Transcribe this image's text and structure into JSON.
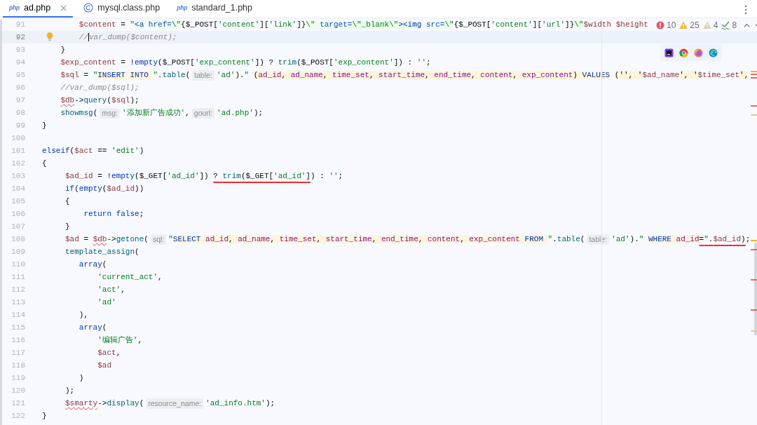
{
  "tabs": [
    {
      "label": "ad.php",
      "kind": "php",
      "badge": "php",
      "selected": true,
      "closable": true
    },
    {
      "label": "mysql.class.php",
      "kind": "class",
      "selected": false,
      "closable": false
    },
    {
      "label": "standard_1.php",
      "kind": "php",
      "badge": "php",
      "selected": false,
      "closable": false
    }
  ],
  "inspections": [
    {
      "kind": "error",
      "count": "10"
    },
    {
      "kind": "warning",
      "count": "25"
    },
    {
      "kind": "weak",
      "count": "4"
    },
    {
      "kind": "typo",
      "count": "8"
    }
  ],
  "lines": [
    {
      "number": "91",
      "current": false,
      "tokens": [
        {
          "text": "        $content",
          "kind": "var"
        },
        {
          "text": " = ",
          "kind": "plain"
        },
        {
          "text": "\"",
          "kind": "str"
        },
        {
          "text": "<a",
          "kind": "htag"
        },
        {
          "text": " href=",
          "kind": "hattr"
        },
        {
          "text": "\\\"",
          "kind": "hstr"
        },
        {
          "text": "{$_POST[",
          "kind": "plain"
        },
        {
          "text": "'content'",
          "kind": "str"
        },
        {
          "text": "][",
          "kind": "plain"
        },
        {
          "text": "'link'",
          "kind": "str"
        },
        {
          "text": "]}",
          "kind": "plain"
        },
        {
          "text": "\\\" ",
          "kind": "hstr"
        },
        {
          "text": "target=",
          "kind": "hattr"
        },
        {
          "text": "\\\"_blank\\\"",
          "kind": "hstr"
        },
        {
          "text": "><img",
          "kind": "htag"
        },
        {
          "text": " src=",
          "kind": "hattr"
        },
        {
          "text": "\\\"",
          "kind": "hstr"
        },
        {
          "text": "{$_POST[",
          "kind": "plain"
        },
        {
          "text": "'content'",
          "kind": "str"
        },
        {
          "text": "][",
          "kind": "plain"
        },
        {
          "text": "'url'",
          "kind": "str"
        },
        {
          "text": "]}",
          "kind": "plain"
        },
        {
          "text": "\\\"",
          "kind": "hstr"
        },
        {
          "text": "$width ",
          "kind": "var"
        },
        {
          "text": "$height",
          "kind": "var"
        }
      ]
    },
    {
      "number": "92",
      "current": true,
      "bulb": true,
      "tokens": [
        {
          "text": "        //",
          "kind": "comment"
        },
        {
          "text": "var_dump($content);",
          "kind": "comment",
          "caret_before": true
        }
      ]
    },
    {
      "number": "93",
      "current": false,
      "tokens": [
        {
          "text": "    }",
          "kind": "plain"
        }
      ]
    },
    {
      "number": "94",
      "current": false,
      "tokens": [
        {
          "text": "    $exp_content",
          "kind": "var"
        },
        {
          "text": " = !",
          "kind": "plain"
        },
        {
          "text": "empty",
          "kind": "kw"
        },
        {
          "text": "($_POST[",
          "kind": "plain"
        },
        {
          "text": "'exp_content'",
          "kind": "str"
        },
        {
          "text": "]) ? ",
          "kind": "plain"
        },
        {
          "text": "trim",
          "kind": "fn"
        },
        {
          "text": "($_POST[",
          "kind": "plain"
        },
        {
          "text": "'exp_content'",
          "kind": "str"
        },
        {
          "text": "]) : ",
          "kind": "plain"
        },
        {
          "text": "''",
          "kind": "str"
        },
        {
          "text": ";",
          "kind": "plain"
        }
      ]
    },
    {
      "number": "95",
      "current": false,
      "tokens": [
        {
          "text": "    $sql",
          "kind": "var"
        },
        {
          "text": " = ",
          "kind": "plain"
        },
        {
          "text": "\"",
          "kind": "str"
        },
        {
          "text": "INSERT INTO ",
          "kind": "sqlkw"
        },
        {
          "text": "\"",
          "kind": "str"
        },
        {
          "text": ".",
          "kind": "plain"
        },
        {
          "text": "table",
          "kind": "fn"
        },
        {
          "text": "(",
          "kind": "plain"
        },
        {
          "text": "table:",
          "kind": "hint"
        },
        {
          "text": "'ad'",
          "kind": "str"
        },
        {
          "text": ").",
          "kind": "plain"
        },
        {
          "text": "\"",
          "kind": "str"
        },
        {
          "text": " (",
          "kind": "sql"
        },
        {
          "text": "ad_id",
          "kind": "sqlid"
        },
        {
          "text": ", ",
          "kind": "sql"
        },
        {
          "text": "ad_name",
          "kind": "sqlid"
        },
        {
          "text": ", ",
          "kind": "sql"
        },
        {
          "text": "time_set",
          "kind": "sqlid"
        },
        {
          "text": ", ",
          "kind": "sql"
        },
        {
          "text": "start_time",
          "kind": "sqlid"
        },
        {
          "text": ", ",
          "kind": "sql"
        },
        {
          "text": "end_time",
          "kind": "sqlid"
        },
        {
          "text": ", ",
          "kind": "sql"
        },
        {
          "text": "content",
          "kind": "sqlid"
        },
        {
          "text": ", ",
          "kind": "sql"
        },
        {
          "text": "exp_content",
          "kind": "sqlid"
        },
        {
          "text": ") ",
          "kind": "sql"
        },
        {
          "text": "VALUES",
          "kind": "sqlkw"
        },
        {
          "text": " ('', '",
          "kind": "sql"
        },
        {
          "text": "$ad_name",
          "kind": "var"
        },
        {
          "text": "', '",
          "kind": "sql"
        },
        {
          "text": "$time_set",
          "kind": "var"
        },
        {
          "text": "',",
          "kind": "sql"
        }
      ]
    },
    {
      "number": "96",
      "current": false,
      "tokens": [
        {
          "text": "    //var_dump($sql);",
          "kind": "comment"
        }
      ]
    },
    {
      "number": "97",
      "current": false,
      "tokens": [
        {
          "text": "    $db",
          "kind": "var",
          "wavy": true
        },
        {
          "text": "->",
          "kind": "plain"
        },
        {
          "text": "query",
          "kind": "fn"
        },
        {
          "text": "(",
          "kind": "plain"
        },
        {
          "text": "$sql",
          "kind": "var"
        },
        {
          "text": ");",
          "kind": "plain"
        }
      ]
    },
    {
      "number": "98",
      "current": false,
      "tokens": [
        {
          "text": "    showmsg",
          "kind": "fn"
        },
        {
          "text": "(",
          "kind": "plain"
        },
        {
          "text": "msg:",
          "kind": "hint"
        },
        {
          "text": "'添加新广告成功'",
          "kind": "str"
        },
        {
          "text": ",",
          "kind": "plain"
        },
        {
          "text": "gourl:",
          "kind": "hint"
        },
        {
          "text": "'ad.php'",
          "kind": "str"
        },
        {
          "text": ");",
          "kind": "plain"
        }
      ]
    },
    {
      "number": "99",
      "current": false,
      "tokens": [
        {
          "text": "}",
          "kind": "plain"
        }
      ]
    },
    {
      "number": "100",
      "current": false
    },
    {
      "number": "101",
      "current": false,
      "tokens": [
        {
          "text": "elseif",
          "kind": "kw"
        },
        {
          "text": "(",
          "kind": "plain"
        },
        {
          "text": "$act",
          "kind": "var"
        },
        {
          "text": " == ",
          "kind": "plain"
        },
        {
          "text": "'edit'",
          "kind": "str"
        },
        {
          "text": ")",
          "kind": "plain"
        }
      ]
    },
    {
      "number": "102",
      "current": false,
      "tokens": [
        {
          "text": "{",
          "kind": "plain"
        }
      ]
    },
    {
      "number": "103",
      "current": false,
      "tokens": [
        {
          "text": "     $ad_id",
          "kind": "var"
        },
        {
          "text": " = !",
          "kind": "plain"
        },
        {
          "text": "empty",
          "kind": "kw"
        },
        {
          "text": "($_GET[",
          "kind": "plain"
        },
        {
          "text": "'ad_id'",
          "kind": "str"
        },
        {
          "text": "]) ",
          "kind": "plain"
        },
        {
          "text": "? ",
          "kind": "plain",
          "error": true
        },
        {
          "text": "trim",
          "kind": "fn",
          "error": true
        },
        {
          "text": "($_GET[",
          "kind": "plain",
          "error": true
        },
        {
          "text": "'ad_id'",
          "kind": "str",
          "error": true
        },
        {
          "text": "]",
          "kind": "plain",
          "error": true
        },
        {
          "text": ") : ",
          "kind": "plain"
        },
        {
          "text": "''",
          "kind": "str"
        },
        {
          "text": ";",
          "kind": "plain"
        }
      ]
    },
    {
      "number": "104",
      "current": false,
      "tokens": [
        {
          "text": "     if",
          "kind": "kw"
        },
        {
          "text": "(",
          "kind": "plain"
        },
        {
          "text": "empty",
          "kind": "kw"
        },
        {
          "text": "(",
          "kind": "plain"
        },
        {
          "text": "$ad_id",
          "kind": "var"
        },
        {
          "text": "))",
          "kind": "plain"
        }
      ]
    },
    {
      "number": "105",
      "current": false,
      "tokens": [
        {
          "text": "     {",
          "kind": "plain"
        }
      ]
    },
    {
      "number": "106",
      "current": false,
      "tokens": [
        {
          "text": "         return ",
          "kind": "kw"
        },
        {
          "text": "false",
          "kind": "kw"
        },
        {
          "text": ";",
          "kind": "plain"
        }
      ]
    },
    {
      "number": "107",
      "current": false,
      "tokens": [
        {
          "text": "     }",
          "kind": "plain"
        }
      ]
    },
    {
      "number": "108",
      "current": false,
      "tokens": [
        {
          "text": "     $ad",
          "kind": "var"
        },
        {
          "text": " = ",
          "kind": "plain"
        },
        {
          "text": "$db",
          "kind": "var",
          "wavy": true
        },
        {
          "text": "->",
          "kind": "plain"
        },
        {
          "text": "getone",
          "kind": "fn"
        },
        {
          "text": "(",
          "kind": "plain"
        },
        {
          "text": "sql:",
          "kind": "hint"
        },
        {
          "text": "\"",
          "kind": "str"
        },
        {
          "text": "SELECT ",
          "kind": "sqlkw"
        },
        {
          "text": "ad_id",
          "kind": "sqlid"
        },
        {
          "text": ", ",
          "kind": "sql"
        },
        {
          "text": "ad_name",
          "kind": "sqlid"
        },
        {
          "text": ", ",
          "kind": "sql"
        },
        {
          "text": "time_set",
          "kind": "sqlid"
        },
        {
          "text": ", ",
          "kind": "sql"
        },
        {
          "text": "start_time",
          "kind": "sqlid"
        },
        {
          "text": ", ",
          "kind": "sql"
        },
        {
          "text": "end_time",
          "kind": "sqlid"
        },
        {
          "text": ", ",
          "kind": "sql"
        },
        {
          "text": "content",
          "kind": "sqlid"
        },
        {
          "text": ", ",
          "kind": "sql"
        },
        {
          "text": "exp_content ",
          "kind": "sqlid"
        },
        {
          "text": "FROM ",
          "kind": "sqlkw"
        },
        {
          "text": "\"",
          "kind": "str"
        },
        {
          "text": ".",
          "kind": "plain"
        },
        {
          "text": "table",
          "kind": "fn"
        },
        {
          "text": "(",
          "kind": "plain"
        },
        {
          "text": "table:",
          "kind": "hint"
        },
        {
          "text": "'ad'",
          "kind": "str"
        },
        {
          "text": ").",
          "kind": "plain"
        },
        {
          "text": "\"",
          "kind": "str"
        },
        {
          "text": " WHERE ",
          "kind": "sqlkw"
        },
        {
          "text": "ad_id",
          "kind": "sqlid"
        },
        {
          "text": "=",
          "kind": "sql",
          "error": true
        },
        {
          "text": "\"",
          "kind": "str",
          "error": true
        },
        {
          "text": ".",
          "kind": "plain",
          "error": true
        },
        {
          "text": "$ad_id",
          "kind": "var",
          "error": true
        },
        {
          "text": ")",
          "kind": "plain",
          "error": true
        },
        {
          "text": ";",
          "kind": "plain"
        }
      ]
    },
    {
      "number": "109",
      "current": false,
      "tokens": [
        {
          "text": "     template_assign",
          "kind": "fn"
        },
        {
          "text": "(",
          "kind": "plain"
        }
      ]
    },
    {
      "number": "110",
      "current": false,
      "tokens": [
        {
          "text": "        array",
          "kind": "kw"
        },
        {
          "text": "(",
          "kind": "plain"
        }
      ]
    },
    {
      "number": "111",
      "current": false,
      "tokens": [
        {
          "text": "            'current_act'",
          "kind": "str"
        },
        {
          "text": ",",
          "kind": "plain"
        }
      ]
    },
    {
      "number": "112",
      "current": false,
      "tokens": [
        {
          "text": "            'act'",
          "kind": "str"
        },
        {
          "text": ",",
          "kind": "plain"
        }
      ]
    },
    {
      "number": "113",
      "current": false,
      "tokens": [
        {
          "text": "            'ad'",
          "kind": "str"
        }
      ]
    },
    {
      "number": "114",
      "current": false,
      "tokens": [
        {
          "text": "        ),",
          "kind": "plain"
        }
      ]
    },
    {
      "number": "115",
      "current": false,
      "tokens": [
        {
          "text": "        array",
          "kind": "kw"
        },
        {
          "text": "(",
          "kind": "plain"
        }
      ]
    },
    {
      "number": "116",
      "current": false,
      "tokens": [
        {
          "text": "            '编辑广告'",
          "kind": "str"
        },
        {
          "text": ",",
          "kind": "plain"
        }
      ]
    },
    {
      "number": "117",
      "current": false,
      "tokens": [
        {
          "text": "            $act",
          "kind": "var"
        },
        {
          "text": ",",
          "kind": "plain"
        }
      ]
    },
    {
      "number": "118",
      "current": false,
      "tokens": [
        {
          "text": "            $ad",
          "kind": "var"
        }
      ]
    },
    {
      "number": "119",
      "current": false,
      "tokens": [
        {
          "text": "        )",
          "kind": "plain"
        }
      ]
    },
    {
      "number": "120",
      "current": false,
      "tokens": [
        {
          "text": "     );",
          "kind": "plain"
        }
      ]
    },
    {
      "number": "121",
      "current": false,
      "tokens": [
        {
          "text": "     $smarty",
          "kind": "var",
          "wavy": true
        },
        {
          "text": "->",
          "kind": "plain"
        },
        {
          "text": "display",
          "kind": "fn"
        },
        {
          "text": "(",
          "kind": "plain"
        },
        {
          "text": "resource_name:",
          "kind": "hint"
        },
        {
          "text": "'ad_info.htm'",
          "kind": "str"
        },
        {
          "text": ");",
          "kind": "plain"
        }
      ]
    },
    {
      "number": "122",
      "current": false,
      "tokens": [
        {
          "text": "}",
          "kind": "plain"
        }
      ]
    }
  ]
}
